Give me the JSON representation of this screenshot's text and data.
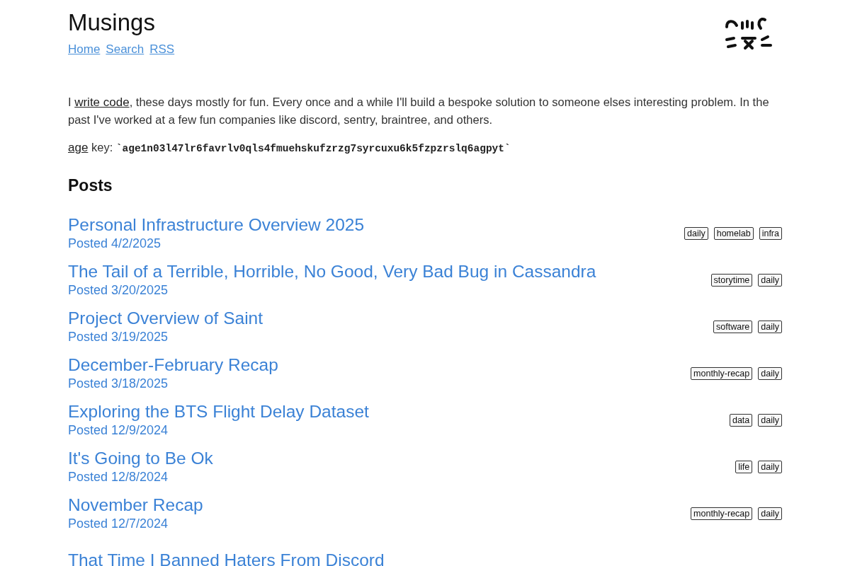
{
  "site": {
    "title": "Musings",
    "nav": [
      "Home",
      "Search",
      "RSS"
    ]
  },
  "intro": {
    "before": "I ",
    "link": "write code",
    "after": ", these days mostly for fun. Every once and a while I'll build a bespoke solution to someone elses interesting problem. In the past I've worked at a few fun companies like discord, sentry, braintree, and others."
  },
  "key": {
    "link": "age",
    "label": " key: ",
    "value": "`age1n03l47lr6favrlv0qls4fmuehskufzrzg7syrcuxu6k5fzpzrslq6agpyt`"
  },
  "posts_heading": "Posts",
  "posts": [
    {
      "title": "Personal Infrastructure Overview 2025",
      "date": "Posted 4/2/2025",
      "tags": [
        "daily",
        "homelab",
        "infra"
      ]
    },
    {
      "title": "The Tail of a Terrible, Horrible, No Good, Very Bad Bug in Cassandra",
      "date": "Posted 3/20/2025",
      "tags": [
        "storytime",
        "daily"
      ]
    },
    {
      "title": "Project Overview of Saint",
      "date": "Posted 3/19/2025",
      "tags": [
        "software",
        "daily"
      ]
    },
    {
      "title": "December-February Recap",
      "date": "Posted 3/18/2025",
      "tags": [
        "monthly-recap",
        "daily"
      ]
    },
    {
      "title": "Exploring the BTS Flight Delay Dataset",
      "date": "Posted 12/9/2024",
      "tags": [
        "data",
        "daily"
      ]
    },
    {
      "title": "It's Going to Be Ok",
      "date": "Posted 12/8/2024",
      "tags": [
        "life",
        "daily"
      ]
    },
    {
      "title": "November Recap",
      "date": "Posted 12/7/2024",
      "tags": [
        "monthly-recap",
        "daily"
      ]
    },
    {
      "title": "That Time I Banned Haters From Discord"
    }
  ]
}
